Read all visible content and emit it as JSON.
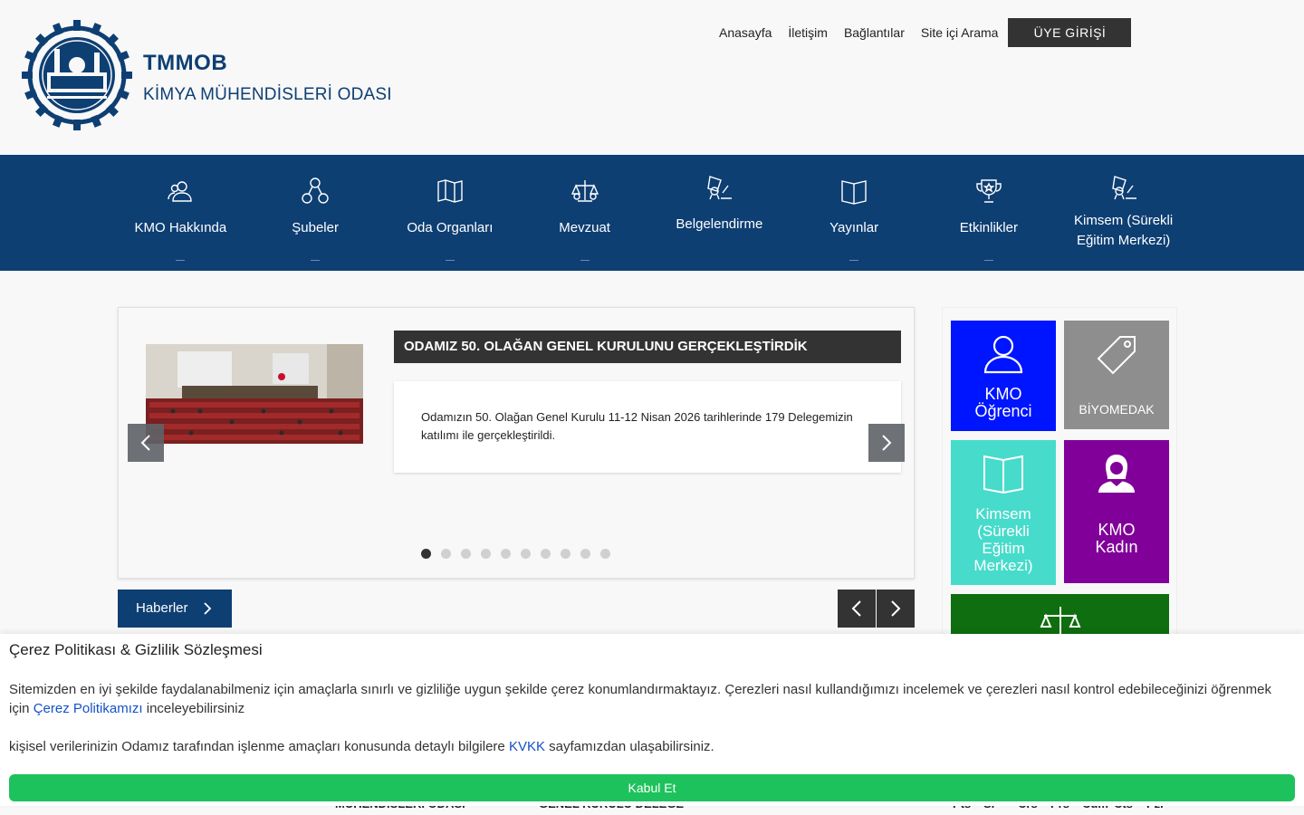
{
  "brand": {
    "name": "TMMOB",
    "subtitle": "KİMYA MÜHENDİSLERİ ODASI"
  },
  "topnav": {
    "items": [
      "Anasayfa",
      "İletişim",
      "Bağlantılar",
      "Site içi Arama"
    ],
    "login": "ÜYE GİRİŞİ"
  },
  "mainnav": [
    {
      "label": "KMO Hakkında",
      "icon": "users-icon"
    },
    {
      "label": "Şubeler",
      "icon": "network-icon"
    },
    {
      "label": "Oda Organları",
      "icon": "map-icon"
    },
    {
      "label": "Mevzuat",
      "icon": "scale-icon"
    },
    {
      "label": "Belgelendirme",
      "icon": "certificate-icon"
    },
    {
      "label": "Yayınlar",
      "icon": "book-icon"
    },
    {
      "label": "Etkinlikler",
      "icon": "trophy-icon"
    },
    {
      "label": "Kimsem (Sürekli Eğitim Merkezi)",
      "icon": "certificate-icon"
    }
  ],
  "slider": {
    "title": "ODAMIZ 50. OLAĞAN GENEL KURULUNU GERÇEKLEŞTİRDİK",
    "text": "Odamızın 50. Olağan Genel Kurulu 11-12 Nisan 2026 tarihlerinde 179 Delegemizin katılımı ile gerçekleştirildi.",
    "dot_count": 10,
    "active_dot": 0
  },
  "news_button": "Haberler",
  "tiles": [
    {
      "label": "KMO Öğrenci",
      "icon": "user-icon",
      "color": "#0015ff"
    },
    {
      "label": "BİYOMEDAK",
      "icon": "tag-icon",
      "color": "#8e8e8e"
    },
    {
      "label": "Kimsem (Sürekli Eğitim Merkezi)",
      "icon": "book-icon",
      "color": "#47dbcb"
    },
    {
      "label": "KMO Kadın",
      "icon": "woman-icon",
      "color": "#800099"
    },
    {
      "label": "",
      "icon": "scale-icon",
      "color": "#0f6e0f"
    }
  ],
  "peek": {
    "card1": "MÜHENDİSLERİ ODASI",
    "card2": "GENEL KURULU DELEGE",
    "calendar_days": [
      "Pts",
      "Sl",
      "Crs",
      "Prs",
      "Cum",
      "Cts",
      "Pzr"
    ]
  },
  "cookie": {
    "title": "Çerez Politikası & Gizlilik Sözleşmesi",
    "p1_before": "Sitemizden en iyi şekilde faydalanabilmeniz için amaçlarla sınırlı ve gizliliğe uygun şekilde çerez konumlandırmaktayız. Çerezleri nasıl kullandığımızı incelemek ve çerezleri nasıl kontrol edebileceğinizi öğrenmek için ",
    "p1_link": "Çerez Politikamızı",
    "p1_after": " inceleyebilirsiniz",
    "p2_before": "kişisel verilerinizin Odamız tarafından işlenme amaçları konusunda detaylı bilgilere ",
    "p2_link": "KVKK",
    "p2_after": " sayfamızdan ulaşabilirsiniz.",
    "accept": "Kabul Et"
  },
  "colors": {
    "brand_blue": "#0e3f73",
    "dark": "#333333",
    "accept_green": "#1ec25c",
    "link_blue": "#1450c8"
  }
}
